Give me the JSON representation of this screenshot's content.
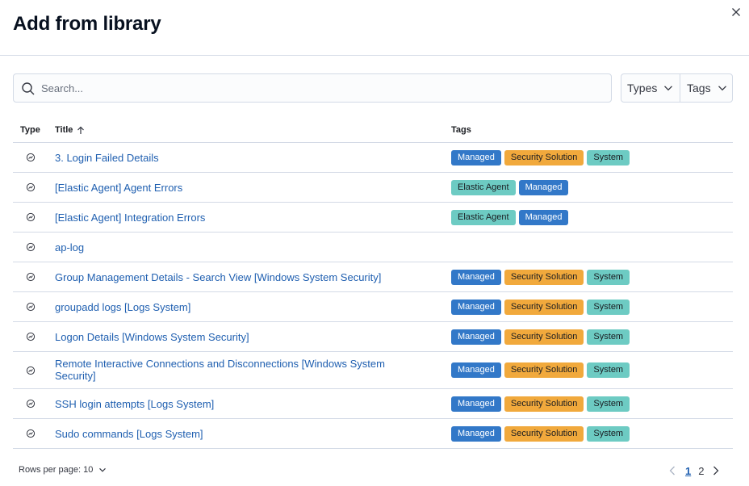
{
  "flyout": {
    "title": "Add from library",
    "close_icon": "close-icon"
  },
  "search": {
    "placeholder": "Search...",
    "value": ""
  },
  "filters": {
    "types_label": "Types",
    "tags_label": "Tags"
  },
  "table": {
    "columns": {
      "type": "Type",
      "title": "Title",
      "tags": "Tags"
    },
    "sort": "ascending",
    "rows": [
      {
        "title": "3. Login Failed Details",
        "type_icon": "visualization-icon",
        "tags": [
          "Managed",
          "Security Solution",
          "System"
        ]
      },
      {
        "title": "[Elastic Agent] Agent Errors",
        "type_icon": "visualization-icon",
        "tags": [
          "Elastic Agent",
          "Managed"
        ]
      },
      {
        "title": "[Elastic Agent] Integration Errors",
        "type_icon": "visualization-icon",
        "tags": [
          "Elastic Agent",
          "Managed"
        ]
      },
      {
        "title": "ap-log",
        "type_icon": "visualization-icon",
        "tags": []
      },
      {
        "title": "Group Management Details - Search View [Windows System Security]",
        "type_icon": "visualization-icon",
        "tags": [
          "Managed",
          "Security Solution",
          "System"
        ]
      },
      {
        "title": "groupadd logs [Logs System]",
        "type_icon": "visualization-icon",
        "tags": [
          "Managed",
          "Security Solution",
          "System"
        ]
      },
      {
        "title": "Logon Details [Windows System Security]",
        "type_icon": "visualization-icon",
        "tags": [
          "Managed",
          "Security Solution",
          "System"
        ]
      },
      {
        "title": "Remote Interactive Connections and Disconnections [Windows System Security]",
        "type_icon": "visualization-icon",
        "tags": [
          "Managed",
          "Security Solution",
          "System"
        ]
      },
      {
        "title": "SSH login attempts [Logs System]",
        "type_icon": "visualization-icon",
        "tags": [
          "Managed",
          "Security Solution",
          "System"
        ]
      },
      {
        "title": "Sudo commands [Logs System]",
        "type_icon": "visualization-icon",
        "tags": [
          "Managed",
          "Security Solution",
          "System"
        ]
      }
    ]
  },
  "tag_colors": {
    "Managed": "#3278c8",
    "Security Solution": "#f1a93c",
    "System": "#6dcbc3",
    "Elastic Agent": "#6dcbc3"
  },
  "footer": {
    "rows_per_page_label": "Rows per page: 10",
    "pages": [
      "1",
      "2"
    ],
    "current_page": "1"
  }
}
